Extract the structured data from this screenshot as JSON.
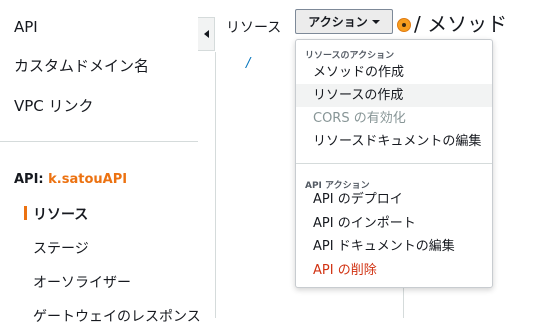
{
  "sidebar": {
    "top_items": [
      "API",
      "カスタムドメイン名",
      "VPC リンク"
    ],
    "api_prefix": "API: ",
    "api_name": "k.satouAPI",
    "sub_items": [
      {
        "label": "リソース",
        "active": true
      },
      {
        "label": "ステージ",
        "active": false
      },
      {
        "label": "オーソライザー",
        "active": false
      },
      {
        "label": "ゲートウェイのレスポンス",
        "active": false
      }
    ]
  },
  "main": {
    "resources_title": "リソース",
    "actions_button": "アクション",
    "method_title": "/ メソッド",
    "tree_root": "/"
  },
  "dropdown": {
    "resource_header": "リソースのアクション",
    "resource_actions": [
      {
        "label": "メソッドの作成",
        "state": "normal"
      },
      {
        "label": "リソースの作成",
        "state": "hover"
      },
      {
        "label": "CORS の有効化",
        "state": "disabled"
      },
      {
        "label": "リソースドキュメントの編集",
        "state": "normal"
      }
    ],
    "api_header": "API アクション",
    "api_actions": [
      {
        "label": "API のデプロイ",
        "state": "normal"
      },
      {
        "label": "API のインポート",
        "state": "normal"
      },
      {
        "label": "API ドキュメントの編集",
        "state": "normal"
      },
      {
        "label": "API の削除",
        "state": "danger"
      }
    ]
  },
  "colors": {
    "accent": "#ec7211",
    "danger": "#d13212",
    "link": "#0073bb"
  }
}
